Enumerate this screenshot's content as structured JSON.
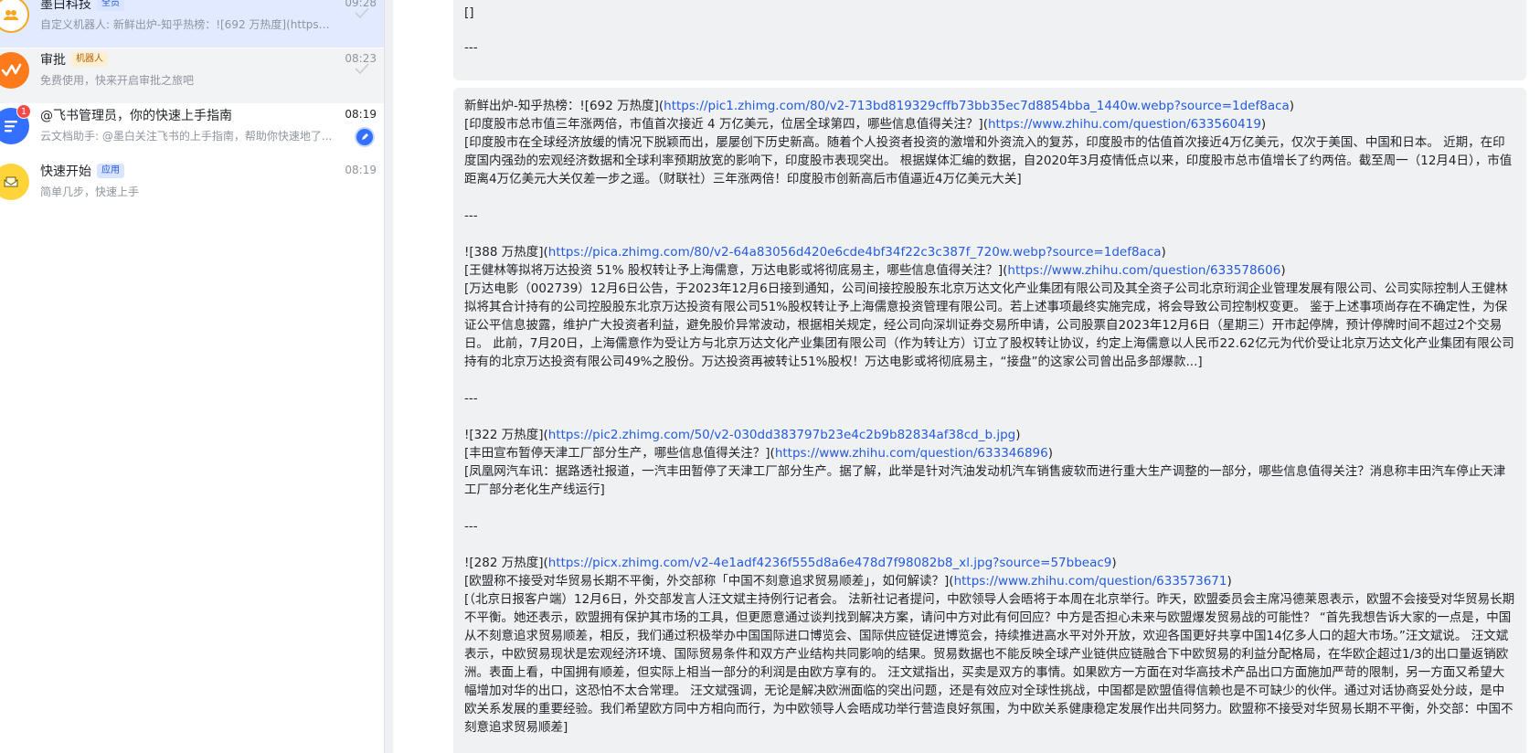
{
  "colors": {
    "accent": "#3370ff",
    "link": "#245bdb",
    "selected_bg": "#e1eaff",
    "bubble_bg": "#f0f1f3",
    "unread": "#f54a45"
  },
  "chats": [
    {
      "name": "墨白科技",
      "tag": "全员",
      "time": "09:28",
      "preview": "自定义机器人: 新鲜出炉-知乎热榜：![692 万热度](https://...",
      "icon": "group-icon"
    },
    {
      "name": "审批",
      "tag": "机器人",
      "time": "08:23",
      "preview": "免费使用，快来开启审批之旅吧",
      "icon": "approval-icon"
    },
    {
      "name": "@飞书管理员，你的快速上手指南",
      "time": "08:19",
      "preview": "云文档助手: @墨白关注飞书的上手指南，帮助你快速地了...",
      "unread": "1",
      "icon": "doc-icon"
    },
    {
      "name": "快速开始",
      "tag": "应用",
      "time": "08:19",
      "preview": "简单几步，快速上手",
      "icon": "quickstart-icon"
    }
  ],
  "top_message": {
    "line1": "[]",
    "line2": "---"
  },
  "message": {
    "header_prefix": "新鲜出炉-知乎热榜：![692 万热度](",
    "header_link": "https://pic1.zhimg.com/80/v2-713bd819329cffb73bb35ec7d8854bba_1440w.webp?source=1def8aca",
    "header_suffix": ")",
    "item1_title_prefix": "[印度股市总市值三年涨两倍，市值首次接近 4 万亿美元，位居全球第四，哪些信息值得关注？](",
    "item1_title_link": "https://www.zhihu.com/question/633560419",
    "item1_title_suffix": ")",
    "item1_body": "[印度股市在全球经济放缓的情况下脱颖而出，屡屡创下历史新高。随着个人投资者投资的激增和外资流入的复苏，印度股市的估值首次接近4万亿美元，仅次于美国、中国和日本。 近期，在印度国内强劲的宏观经济数据和全球利率预期放宽的影响下，印度股市表现突出。 根据媒体汇编的数据，自2020年3月疫情低点以来，印度股市总市值增长了约两倍。截至周一（12月4日），市值距离4万亿美元大关仅差一步之遥。（财联社）三年涨两倍！印度股市创新高后市值逼近4万亿美元大关]",
    "sep1": "---",
    "item2_img_prefix": "![388 万热度](",
    "item2_img_link": "https://pica.zhimg.com/80/v2-64a83056d420e6cde4bf34f22c3c387f_720w.webp?source=1def8aca",
    "item2_img_suffix": ")",
    "item2_title_prefix": "[王健林等拟将万达投资 51% 股权转让予上海儒意，万达电影或将彻底易主，哪些信息值得关注？](",
    "item2_title_link": "https://www.zhihu.com/question/633578606",
    "item2_title_suffix": ")",
    "item2_body": "[万达电影（002739）12月6日公告，于2023年12月6日接到通知，公司间接控股股东北京万达文化产业集团有限公司及其全资子公司北京珩润企业管理发展有限公司、公司实际控制人王健林拟将其合计持有的公司控股股东北京万达投资有限公司51%股权转让予上海儒意投资管理有限公司。若上述事项最终实施完成，将会导致公司控制权变更。 鉴于上述事项尚存在不确定性，为保证公平信息披露，维护广大投资者利益，避免股价异常波动，根据相关规定，经公司向深圳证券交易所申请，公司股票自2023年12月6日（星期三）开市起停牌，预计停牌时间不超过2个交易日。 此前，7月20日，上海儒意作为受让方与北京万达文化产业集团有限公司（作为转让方）订立了股权转让协议，约定上海儒意以人民币22.62亿元为代价受让北京万达文化产业集团有限公司持有的北京万达投资有限公司49%之股份。万达投资再被转让51%股权！万达电影或将彻底易主，“接盘”的这家公司曾出品多部爆款...]",
    "sep2": "---",
    "item3_img_prefix": "![322 万热度](",
    "item3_img_link": "https://pic2.zhimg.com/50/v2-030dd383797b23e4c2b9b82834af38cd_b.jpg",
    "item3_img_suffix": ")",
    "item3_title_prefix": "[丰田宣布暂停天津工厂部分生产，哪些信息值得关注？](",
    "item3_title_link": "https://www.zhihu.com/question/633346896",
    "item3_title_suffix": ")",
    "item3_body": "[凤凰网汽车讯：据路透社报道，一汽丰田暂停了天津工厂部分生产。据了解，此举是针对汽油发动机汽车销售疲软而进行重大生产调整的一部分，哪些信息值得关注？消息称丰田汽车停止天津工厂部分老化生产线运行]",
    "sep3": "---",
    "item4_img_prefix": "![282 万热度](",
    "item4_img_link": "https://picx.zhimg.com/v2-4e1adf4236f555d8a6e478d7f98082b8_xl.jpg?source=57bbeac9",
    "item4_img_suffix": ")",
    "item4_title_prefix": "[欧盟称不接受对华贸易长期不平衡，外交部称「中国不刻意追求贸易顺差」，如何解读？](",
    "item4_title_link": "https://www.zhihu.com/question/633573671",
    "item4_title_suffix": ")",
    "item4_body": "[（北京日报客户端）12月6日，外交部发言人汪文斌主持例行记者会。 法新社记者提问，中欧领导人会晤将于本周在北京举行。昨天，欧盟委员会主席冯德莱恩表示，欧盟不会接受对华贸易长期不平衡。她还表示，欧盟拥有保护其市场的工具，但更愿意通过谈判找到解决方案，请问中方对此有何回应？中方是否担心未来与欧盟爆发贸易战的可能性？ “首先我想告诉大家的一点是，中国从不刻意追求贸易顺差，相反，我们通过积极举办中国国际进口博览会、国际供应链促进博览会，持续推进高水平对外开放，欢迎各国更好共享中国14亿多人口的超大市场。”汪文斌说。 汪文斌表示，中欧贸易现状是宏观经济环境、国际贸易条件和双方产业结构共同影响的结果。贸易数据也不能反映全球产业链供应链融合下中欧贸易的利益分配格局，在华欧企超过1/3的出口量返销欧洲。表面上看，中国拥有顺差，但实际上相当一部分的利润是由欧方享有的。 汪文斌指出，买卖是双方的事情。如果欧方一方面在对华高技术产品出口方面施加严苛的限制，另一方面又希望大幅增加对华的出口，这恐怕不太合常理。 汪文斌强调，无论是解决欧洲面临的突出问题，还是有效应对全球性挑战，中国都是欧盟值得信赖也是不可缺少的伙伴。通过对话协商妥处分歧，是中欧关系发展的重要经验。我们希望欧方同中方相向而行，为中欧领导人会晤成功举行营造良好氛围，为中欧关系健康稳定发展作出共同努力。欧盟称不接受对华贸易长期不平衡，外交部：中国不刻意追求贸易顺差]"
  }
}
